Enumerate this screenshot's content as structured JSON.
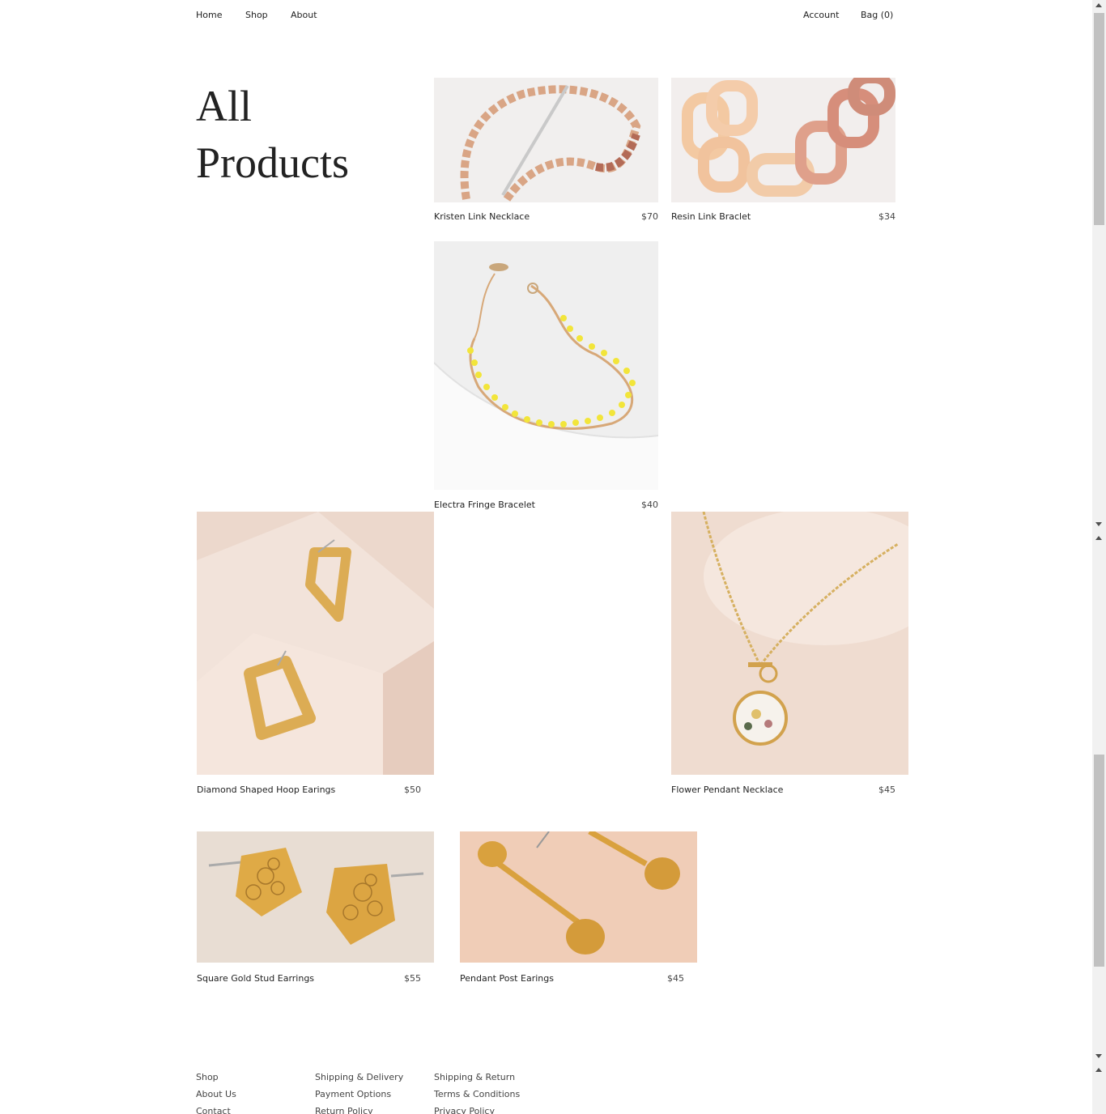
{
  "nav": {
    "home": "Home",
    "shop": "Shop",
    "about": "About",
    "account": "Account",
    "bag": "Bag (0)"
  },
  "page": {
    "title_line1": "All",
    "title_line2": "Products"
  },
  "products": [
    {
      "name": "Kristen Link Necklace",
      "price": "$70"
    },
    {
      "name": "Resin Link Braclet",
      "price": "$34"
    },
    {
      "name": "Electra Fringe Bracelet",
      "price": "$40"
    },
    {
      "name": "Diamond Shaped Hoop Earings",
      "price": "$50"
    },
    {
      "name": "Flower Pendant Necklace",
      "price": "$45"
    },
    {
      "name": "Square Gold Stud Earrings",
      "price": "$55"
    },
    {
      "name": "Pendant Post Earings",
      "price": "$45"
    }
  ],
  "footer": {
    "col1": [
      "Shop",
      "About Us",
      "Contact"
    ],
    "col2": [
      "Shipping & Delivery",
      "Payment Options",
      "Return Policy"
    ],
    "col3": [
      "Shipping & Return",
      "Terms & Conditions",
      "Privacy Policy"
    ]
  },
  "colors": {
    "background": "#ffffff",
    "text": "#222222",
    "blush": "#efd9cc",
    "gold": "#d9a842"
  }
}
